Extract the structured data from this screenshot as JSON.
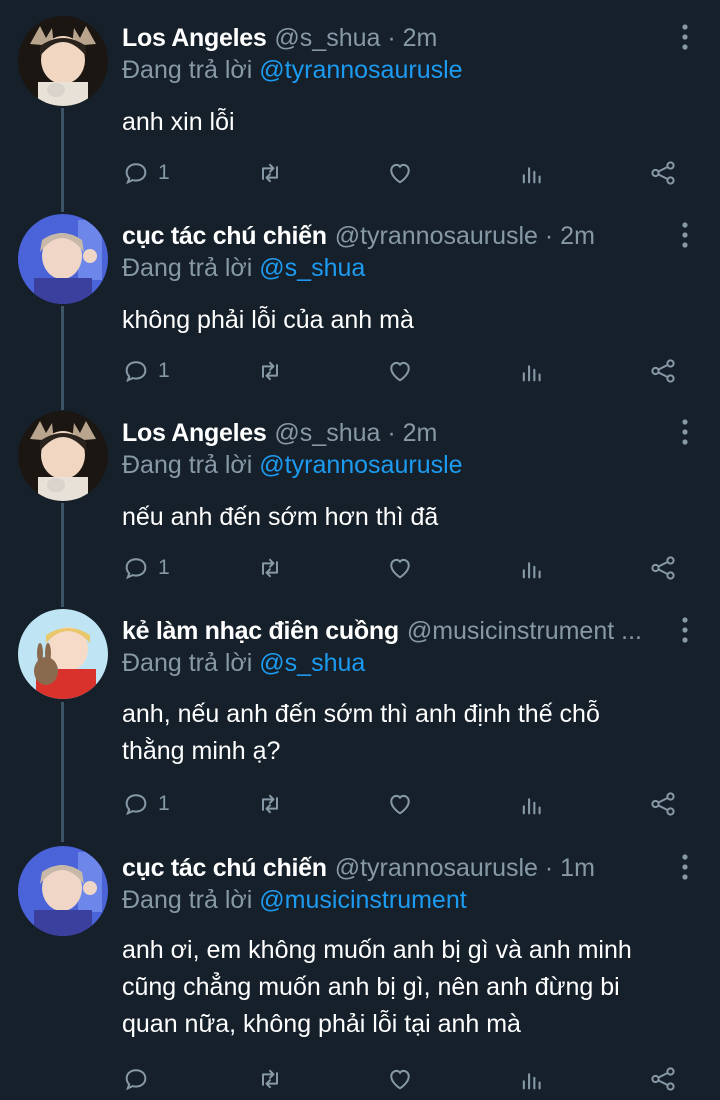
{
  "replying_prefix": "Đang trả lời",
  "tweets": [
    {
      "name": "Los Angeles",
      "handle": "@s_shua · 2m",
      "reply_to": "@tyrannosaurusle",
      "text": [
        "anh xin lỗi"
      ],
      "reply_count": "1",
      "avatar": "deer-antler-boy"
    },
    {
      "name": "cục tác chú chiến",
      "handle": "@tyrannosaurusle · 2m",
      "reply_to": "@s_shua",
      "text": [
        "không phải lỗi của anh mà"
      ],
      "reply_count": "1",
      "avatar": "blue-background-boy"
    },
    {
      "name": "Los Angeles",
      "handle": "@s_shua · 2m",
      "reply_to": "@tyrannosaurusle",
      "text": [
        "nếu anh đến sớm hơn thì đã"
      ],
      "reply_count": "1",
      "avatar": "deer-antler-boy"
    },
    {
      "name": "kẻ làm nhạc điên cuồng",
      "handle": "@musicinstrument ...",
      "reply_to": "@s_shua",
      "text": [
        "anh, nếu anh đến sớm thì anh định thế chỗ",
        "thằng minh ạ?"
      ],
      "reply_count": "1",
      "avatar": "bunny-red-sweater-boy"
    },
    {
      "name": "cục tác chú chiến",
      "handle": "@tyrannosaurusle · 1m",
      "reply_to": "@musicinstrument",
      "text": [
        "anh ơi, em không muốn anh bị gì và anh minh",
        "cũng chẳng muốn anh bị gì, nên anh đừng bi",
        "quan nữa, không phải lỗi tại anh mà"
      ],
      "reply_count": "",
      "avatar": "blue-background-boy"
    }
  ],
  "colors": {
    "background": "#15202b",
    "mention": "#1d9bf0",
    "secondary_text": "#8899a6",
    "thread_line": "#3d5466"
  }
}
